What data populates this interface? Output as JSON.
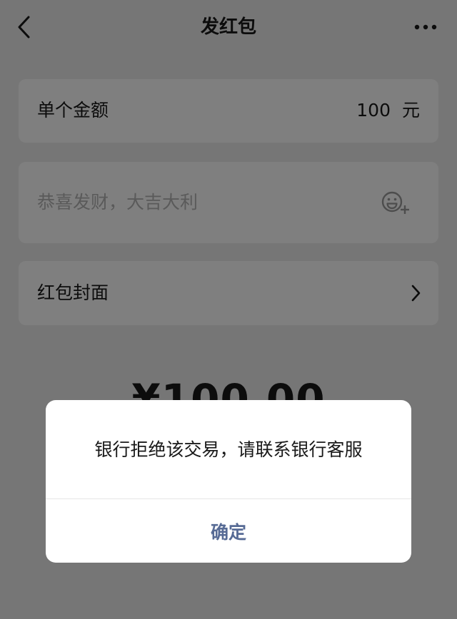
{
  "header": {
    "title": "发红包",
    "back_icon": "chevron-left-icon",
    "more_icon": "more-dots-icon"
  },
  "amount_card": {
    "label": "单个金额",
    "value": "100",
    "unit": "元"
  },
  "greeting_card": {
    "placeholder": "恭喜发财，大吉大利",
    "emoji_icon": "emoji-add-icon"
  },
  "cover_card": {
    "label": "红包封面",
    "chevron_icon": "chevron-right-icon"
  },
  "total": {
    "display": "¥100.00"
  },
  "dialog": {
    "message": "银行拒绝该交易，请联系银行客服",
    "confirm_label": "确定"
  },
  "colors": {
    "background": "#ededed",
    "card": "#ffffff",
    "link_blue": "#576b95",
    "placeholder": "#b4b4b4"
  }
}
